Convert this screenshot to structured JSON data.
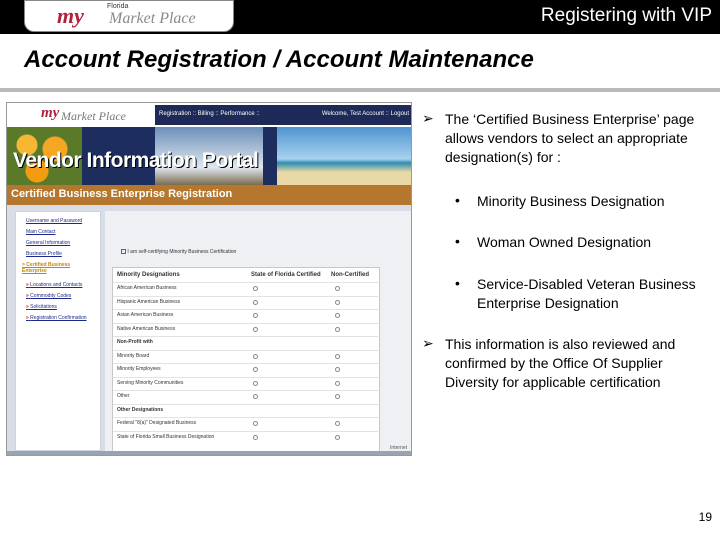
{
  "header": {
    "logo_my": "my",
    "logo_florida": "Florida",
    "logo_market_place": "Market Place",
    "title": "Registering with VIP"
  },
  "page_title": "Account Registration / Account Maintenance",
  "screenshot": {
    "logo_my": "my",
    "logo_market_place": "Market Place",
    "nav_left": "Registration :: Billing :: Performance ::",
    "nav_right": "Welcome, Test Account :: Logout",
    "banner_title": "Vendor Information Portal",
    "sub_title": "Certified Business Enterprise Registration",
    "left_nav": [
      {
        "label": "Username and Password",
        "active": false,
        "mark": ""
      },
      {
        "label": "Main Contact",
        "active": false,
        "mark": ""
      },
      {
        "label": "General Information",
        "active": false,
        "mark": ""
      },
      {
        "label": "Business Profile",
        "active": false,
        "mark": ""
      },
      {
        "label": "> Certified Business Enterprise",
        "active": true,
        "mark": ""
      },
      {
        "label": "Locations and Contacts",
        "active": false,
        "mark": "»"
      },
      {
        "label": "Commodity Codes",
        "active": false,
        "mark": "»"
      },
      {
        "label": "Solicitations",
        "active": false,
        "mark": "»"
      },
      {
        "label": "Registration Confirmation",
        "active": false,
        "mark": "»"
      }
    ],
    "checkbox_label": "I am self-certifying Minority Business Certification",
    "table_headers": [
      "Minority Designations",
      "State of Florida Certified",
      "Non-Certified"
    ],
    "table_rows": [
      {
        "label": "African American Business",
        "bold": false
      },
      {
        "label": "Hispanic American Business",
        "bold": false
      },
      {
        "label": "Asian American Business",
        "bold": false
      },
      {
        "label": "Native American Business",
        "bold": false
      },
      {
        "label": "Non-Profit with",
        "bold": true
      },
      {
        "label": "Minority Board",
        "bold": false
      },
      {
        "label": "Minority Employees",
        "bold": false
      },
      {
        "label": "Serving Minority Communities",
        "bold": false
      },
      {
        "label": "Other",
        "bold": false
      },
      {
        "label": "Other Designations",
        "bold": true
      },
      {
        "label": "Federal \"8(a)\" Designated Business",
        "bold": false
      },
      {
        "label": "State of Florida Small Business Designation",
        "bold": false
      }
    ],
    "corner_text": "Internet"
  },
  "content": {
    "intro": "The ‘Certified Business Enterprise’ page allows vendors to select an appropriate designation(s) for :",
    "items": [
      "Minority Business Designation",
      "Woman Owned Designation",
      "Service-Disabled Veteran Business Enterprise Designation"
    ],
    "note": "This information is also reviewed and confirmed by the Office Of Supplier Diversity for applicable certification"
  },
  "page_number": "19",
  "colors": {
    "header_bg": "#000000",
    "nav_bg": "#1d2a57",
    "sub_bar": "#b5762d",
    "logo_red": "#b0213b"
  }
}
